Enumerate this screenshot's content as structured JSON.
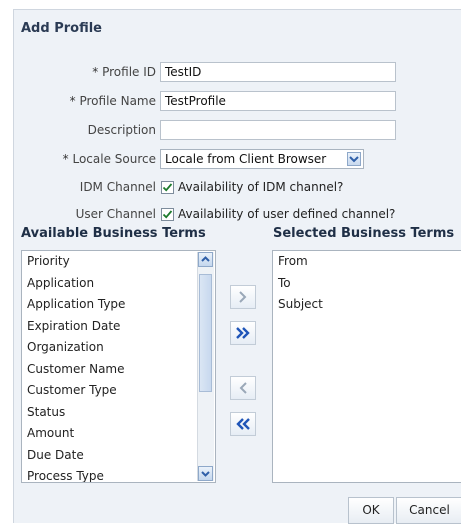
{
  "dialog": {
    "title": "Add Profile"
  },
  "form": {
    "profile_id": {
      "label": "Profile ID",
      "required_mark": "*",
      "value": "TestID"
    },
    "profile_name": {
      "label": "Profile Name",
      "required_mark": "*",
      "value": "TestProfile"
    },
    "description": {
      "label": "Description",
      "value": ""
    },
    "locale_source": {
      "label": "Locale Source",
      "required_mark": "*",
      "value": "Locale from Client Browser"
    },
    "idm_channel": {
      "label": "IDM Channel",
      "checkbox_label": "Availability of IDM channel?",
      "checked": true
    },
    "user_channel": {
      "label": "User Channel",
      "checkbox_label": "Availability of user defined channel?",
      "checked": true
    }
  },
  "available": {
    "title": "Available Business Terms",
    "items": [
      "Priority",
      "Application",
      "Application Type",
      "Expiration Date",
      "Organization",
      "Customer Name",
      "Customer Type",
      "Status",
      "Amount",
      "Due Date",
      "Process Type"
    ]
  },
  "selected": {
    "title": "Selected Business Terms",
    "items": [
      "From",
      "To",
      "Subject"
    ]
  },
  "shuttle": {
    "move_icon": "single-right-chevron-icon",
    "move_all_icon": "double-right-chevron-icon",
    "remove_icon": "single-left-chevron-icon",
    "remove_all_icon": "double-left-chevron-icon"
  },
  "footer": {
    "ok_label": "OK",
    "cancel_label": "Cancel"
  },
  "colors": {
    "dialog_bg": "#eef2f7",
    "accent_blue": "#2f5fa8",
    "title_text": "#2b3b54"
  }
}
